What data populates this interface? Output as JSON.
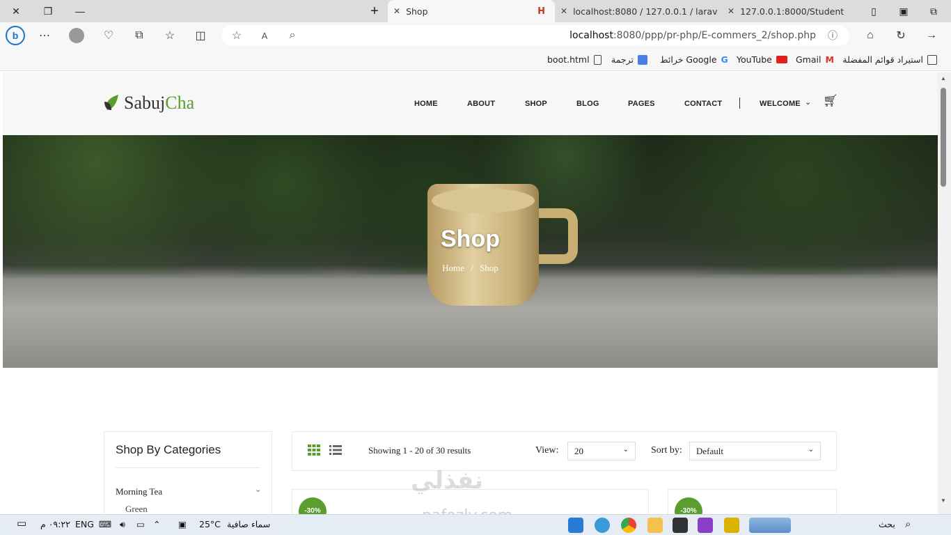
{
  "browser": {
    "tabs": [
      {
        "label": "Shop"
      },
      {
        "label": "localhost:8080 / 127.0.0.1 / larav"
      },
      {
        "label": "127.0.0.1:8000/Student"
      }
    ],
    "url_host": "localhost",
    "url_path": ":8080/ppp/pr-php/E-commers_2/shop.php",
    "favorites": [
      {
        "label": "استيراد قوائم المفضلة"
      },
      {
        "label": "Gmail"
      },
      {
        "label": "YouTube"
      },
      {
        "label": "خرائط Google"
      },
      {
        "label": "ترجمة"
      },
      {
        "label": "boot.html"
      }
    ]
  },
  "site": {
    "logo_part1": "Sabuj",
    "logo_part2": "Cha",
    "menu": [
      "HOME",
      "ABOUT",
      "SHOP",
      "BLOG",
      "PAGES",
      "CONTACT"
    ],
    "welcome": "WELCOME",
    "hero_title": "Shop",
    "breadcrumb_home": "Home",
    "breadcrumb_sep": "/",
    "breadcrumb_current": "Shop"
  },
  "sidebar": {
    "title": "Shop By Categories",
    "category": "Morning Tea",
    "subcategory": "Green"
  },
  "toolbar": {
    "showing": "Showing 1 - 20 of 30 results",
    "view_label": "View:",
    "view_value": "20",
    "sort_label": "Sort by:",
    "sort_value": "Default"
  },
  "products": {
    "badge1": "-30%",
    "badge2": "-30%"
  },
  "watermark": {
    "arabic": "نفذلي",
    "latin": "nafezly.com"
  },
  "taskbar": {
    "search": "بحث",
    "weather_temp": "25°C",
    "weather_text": "سماء صافية",
    "lang": "ENG",
    "time": "٠٩:٢٢ م"
  },
  "colors": {
    "accent": "#5a9e2f",
    "chrome": "#dcdcdc"
  }
}
